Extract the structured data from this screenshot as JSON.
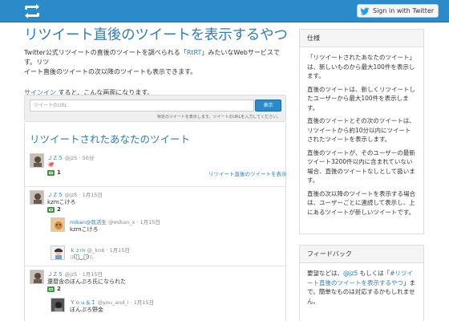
{
  "header": {
    "signin_button": "Sign in with Twitter"
  },
  "main": {
    "title": "リツイート直後のツイートを表示するやつ",
    "intro_line1_a": "Twitter公式リツイートの直後のツイートを調べられる「",
    "intro_line1_link": "RtRT",
    "intro_line1_b": "」みたいなWebサービスです。リツ",
    "intro_line2": "イート直後のツイートの次以降のツイートも表示できます。",
    "signin_link": "サインイン",
    "signin_rest": " すると、こんな画面になります。"
  },
  "search": {
    "placeholder": "ツイートのURL",
    "button": "表示",
    "help": "特定のツイートを表示します。ツイートのURLを入力してください。"
  },
  "panel": {
    "title": "リツイートされたあなたのツイート",
    "show_link": "リツイート直後のツイートを表示",
    "tweets": [
      {
        "name": "ＪＺ５",
        "handle": "@jz5 · 56分",
        "text": "🐙",
        "rt_count": "1"
      },
      {
        "name": "ＪＺ５",
        "handle": "@jz5 · 1月15日",
        "text": "kzmこけろ",
        "rt_count": "2"
      },
      {
        "name": "mikan@就活生",
        "handle": "@mikan_x · 1月15日",
        "text": "kzmこけろ"
      },
      {
        "name": "ｋｚｍ",
        "handle": "@_kn6 · 1月15日",
        "text": "::(ﾟ‿ﾟ)::"
      },
      {
        "name": "ＪＺ５",
        "handle": "@jz5 · 1月15日",
        "text": "還暦含のぼんぷろ氏になられた",
        "rt_count": "2"
      },
      {
        "name": "Ｙｏｕ＆Ｉ",
        "handle": "@you_and_i · 1月15日",
        "text": "ぼんぷろ野金"
      }
    ]
  },
  "sidebar": {
    "spec_title": "仕様",
    "spec_paragraphs": [
      "「リツイートされたあなたのツイート」は、新しいものから最大100件を表示します。",
      "直後のツイートは、新しくリツイートしたユーザーから最大100件を表示します。",
      "直後のツイートとその次のツイートは、リツイートから約10分以内にツイートされたツイートを表示します。",
      "直後のツイートが、そのユーザーの最新ツイート3200件以内に含まれていない場合、直後のツイートなしとして扱います。",
      "直後の次以降のツイートを表示する場合は、ユーザーごとに連続して表示し、上にあるツイートが新しいツイートです。"
    ],
    "feedback_title": "フィードバック",
    "feedback_a": "要望などは、",
    "feedback_link1": "@jz5",
    "feedback_b": " もしくは「",
    "feedback_link2": "#リツイート直後のツイートを表示するやつ",
    "feedback_c": "」まで。簡単なものは対応するかもしれません。"
  },
  "colors": {
    "accent": "#2b8ac8",
    "link": "#2b7dbd",
    "retweet_green": "#3a9a3a"
  }
}
